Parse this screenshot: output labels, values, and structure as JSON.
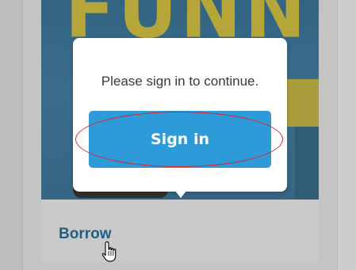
{
  "book": {
    "cover_text": "FUNNY,"
  },
  "popover": {
    "message": "Please sign in to continue.",
    "signin_label": "Sign in"
  },
  "card": {
    "borrow_label": "Borrow"
  },
  "colors": {
    "button_bg": "#2e9ad8",
    "borrow_link": "#1f5e86",
    "highlight": "#d9262b"
  }
}
